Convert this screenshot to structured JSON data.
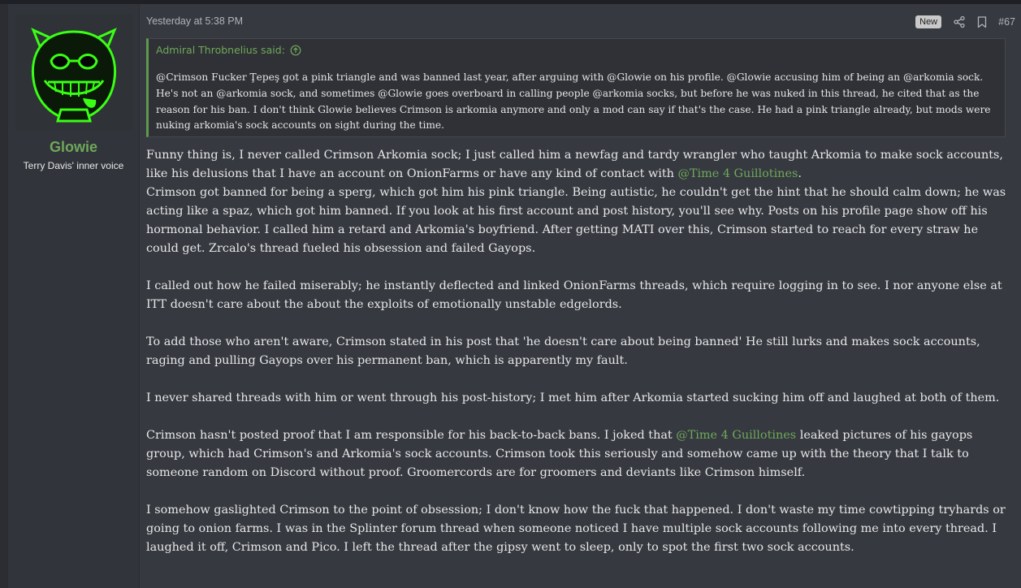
{
  "user": {
    "name": "Glowie",
    "title": "Terry Davis' inner voice",
    "avatar_icon": "glowing-smiley-avatar",
    "accent_color": "#6fa85a"
  },
  "header": {
    "date": "Yesterday at 5:38 PM",
    "badge": "New",
    "share_icon": "share-icon",
    "bookmark_icon": "bookmark-icon",
    "post_number": "#67"
  },
  "quote": {
    "author": "Admiral Throbnelius said:",
    "up_icon": "arrow-up-circle-icon",
    "text": "@Crimson Fucker Ţepeş got a pink triangle and was banned last year, after arguing with @Glowie on his profile. @Glowie accusing him of being an @arkomia sock. He's not an @arkomia sock, and sometimes @Glowie goes overboard in calling people @arkomia socks, but before he was nuked in this thread, he cited that as the reason for his ban. I don't think Glowie believes Crimson is arkomia anymore and only a mod can say if that's the case. He had a pink triangle already, but mods were nuking arkomia's sock accounts on sight during the time."
  },
  "body": {
    "p1_a": "Funny thing is, I never called Crimson Arkomia sock; I just called him a newfag and tardy wrangler who taught Arkomia to make sock accounts, like his delusions that I have an account on OnionFarms or have any kind of contact with ",
    "p1_mention": "@Time 4 Guillotines",
    "p1_b": ".",
    "p1_c": "Crimson got banned for being a sperg, which got him his pink triangle. Being autistic, he couldn't get the hint that he should calm down; he was acting like a spaz, which got him banned. If you look at his first account and post history, you'll see why. Posts on his profile page show off his hormonal behavior. I called him a retard and Arkomia's boyfriend. After getting MATI over this, Crimson started to reach for every straw he could get. Zrcalo's thread fueled his obsession and failed Gayops.",
    "p2": "I called out how he failed miserably; he instantly deflected and linked OnionFarms threads, which require logging in to see. I nor anyone else at ITT doesn't care about the about the exploits of emotionally unstable edgelords.",
    "p3": "To add those who aren't aware, Crimson stated in his post that 'he doesn't care about being banned' He still lurks and makes sock accounts, raging and pulling Gayops over his permanent ban, which is apparently my fault.",
    "p4": "I never shared threads with him or went through his post-history; I met him after Arkomia started sucking him off and laughed at both of them.",
    "p5_a": "Crimson hasn't posted proof that I am responsible for his back-to-back bans. I joked that ",
    "p5_mention": "@Time 4 Guillotines",
    "p5_b": " leaked pictures of his gayops group, which had Crimson's and Arkomia's sock accounts. Crimson took this seriously and somehow came up with the theory that I talk to someone random on Discord without proof. Groomercords are for groomers and deviants like Crimson himself.",
    "p6": "I somehow gaslighted Crimson to the point of obsession; I don't know how the fuck that happened. I don't waste my time cowtipping tryhards or going to onion farms. I was in the Splinter forum thread when someone noticed I have multiple sock accounts following me into every thread. I laughed it off, Crimson and Pico. I left the thread after the gipsy went to sleep, only to spot the first two sock accounts."
  }
}
